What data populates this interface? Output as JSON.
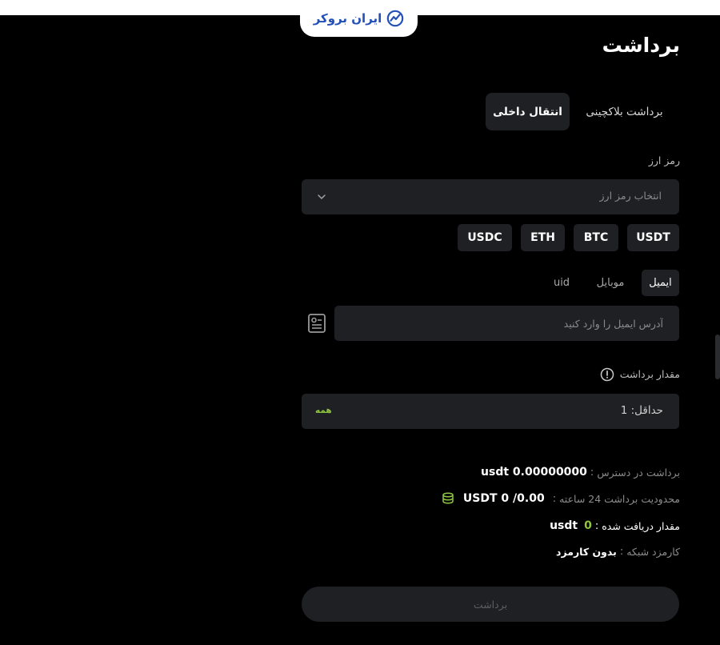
{
  "brand": {
    "name": "ایران بروکر",
    "color": "#2350b8",
    "icon": "chart-trend-icon"
  },
  "page": {
    "title": "برداشت"
  },
  "tabs": [
    {
      "label": "برداشت بلاکچینی",
      "active": false
    },
    {
      "label": "انتقال داخلی",
      "active": true
    }
  ],
  "currency": {
    "label": "رمز ارز",
    "placeholder": "انتخاب رمز ارز",
    "quick": [
      "USDT",
      "BTC",
      "ETH",
      "USDC"
    ]
  },
  "method_tabs": [
    {
      "label": "ایمیل",
      "active": true
    },
    {
      "label": "موبایل",
      "active": false
    },
    {
      "label": "uid",
      "active": false
    }
  ],
  "email": {
    "placeholder": "آدرس ایمیل را وارد کنید",
    "icon": "contact-card-icon"
  },
  "amount": {
    "label": "مقدار برداشت",
    "placeholder": "حداقل: 1",
    "all_label": "همه",
    "icon": "info-icon"
  },
  "summary": {
    "available": {
      "label": "برداشت در دسترس",
      "value": "usdt 0.00000000"
    },
    "limit": {
      "label": "محدودیت برداشت 24 ساعته",
      "value": "USDT 0 /0.00",
      "icon": "coins-icon"
    },
    "received": {
      "label": "مقدار دریافت شده",
      "amount": "0",
      "unit": "usdt"
    },
    "fee": {
      "label": "کارمزد شبکه",
      "value": "بدون کارمزد"
    }
  },
  "submit": {
    "label": "برداشت"
  },
  "colors": {
    "background": "#000000",
    "panel": "#1f2023",
    "accent_green": "#8dc63f"
  }
}
